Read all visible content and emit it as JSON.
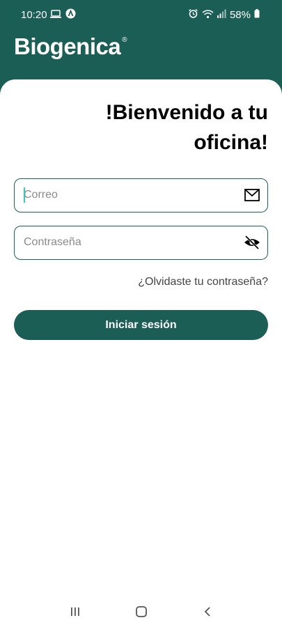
{
  "status_bar": {
    "time": "10:20",
    "battery": "58%",
    "icons": [
      "laptop-icon",
      "app-a-icon",
      "alarm-icon",
      "wifi-icon",
      "signal-icon",
      "battery-icon"
    ]
  },
  "header": {
    "logo_text": "Biogenica",
    "logo_reg": "®"
  },
  "main": {
    "title": "!Bienvenido a tu oficina!",
    "email": {
      "placeholder": "Correo",
      "value": "",
      "icon": "mail-icon"
    },
    "password": {
      "placeholder": "Contraseña",
      "value": "",
      "icon": "eye-off-icon"
    },
    "forgot_link": "¿Olvidaste tu contraseña?",
    "login_button": "Iniciar sesión"
  },
  "nav_bar": {
    "items": [
      "recents-icon",
      "home-icon",
      "back-icon"
    ]
  },
  "colors": {
    "primary": "#1b5e55",
    "caret": "#3cc6b4",
    "background": "#ffffff"
  }
}
